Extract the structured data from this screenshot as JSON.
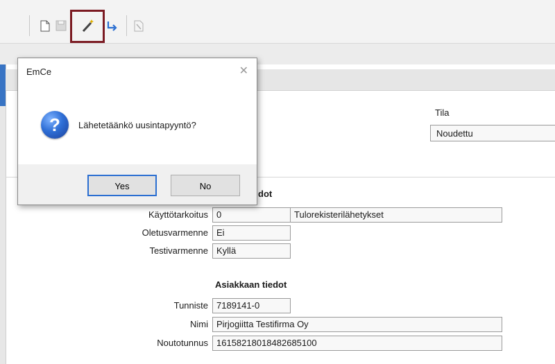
{
  "toolbar": {
    "icons": [
      "new-document-icon",
      "save-icon",
      "magic-wand-icon",
      "resend-arrow-icon",
      "delete-icon"
    ]
  },
  "status": {
    "header": "Tila",
    "value": "Noudettu"
  },
  "certificate": {
    "title_fragment": "dot",
    "usage_label": "Käyttötarkoitus",
    "usage_code": "0",
    "usage_desc": "Tulorekisterilähetykset",
    "default_label": "Oletusvarmenne",
    "default_value": "Ei",
    "test_label": "Testivarmenne",
    "test_value": "Kyllä"
  },
  "customer": {
    "title": "Asiakkaan tiedot",
    "id_label": "Tunniste",
    "id_value": "7189141-0",
    "name_label": "Nimi",
    "name_value": "Pirjogiitta Testifirma Oy",
    "pickup_label": "Noutotunnus",
    "pickup_value": "16158218018482685100"
  },
  "dialog": {
    "title": "EmCe",
    "close_glyph": "✕",
    "icon_glyph": "?",
    "message": "Lähetetäänkö uusintapyyntö?",
    "yes_label": "Yes",
    "no_label": "No"
  }
}
